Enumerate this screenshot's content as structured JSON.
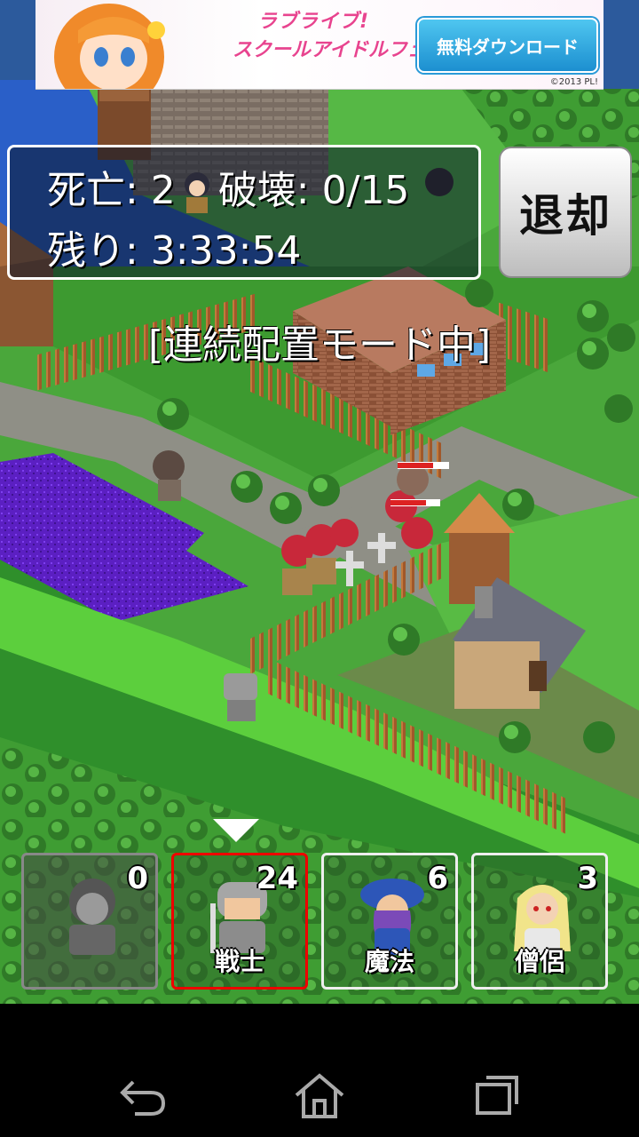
{
  "ad": {
    "logo_line1": "ラブライブ!",
    "logo_line2": "スクールアイドルフェスティバル",
    "button_label": "無料ダウンロード",
    "copyright": "©2013 PL!"
  },
  "status": {
    "deaths_label": "死亡: 2",
    "destroyed_label": "破壊: 0/15",
    "remaining_label": "残り: 3:33:54"
  },
  "retreat_label": "退却",
  "mode_text": "[連続配置モード中]",
  "units": [
    {
      "label": "",
      "count": "0",
      "state": "disabled"
    },
    {
      "label": "戦士",
      "count": "24",
      "state": "selected"
    },
    {
      "label": "魔法",
      "count": "6",
      "state": "normal"
    },
    {
      "label": "僧侶",
      "count": "3",
      "state": "normal"
    }
  ],
  "nav": {
    "back_icon": "back-icon",
    "home_icon": "home-icon",
    "recents_icon": "recents-icon"
  },
  "colors": {
    "grass": "#49b83c",
    "dark_grass": "#2e8a2e",
    "road": "#8f8f86",
    "poison": "#6a1fd0",
    "water": "#2a5fc8"
  }
}
